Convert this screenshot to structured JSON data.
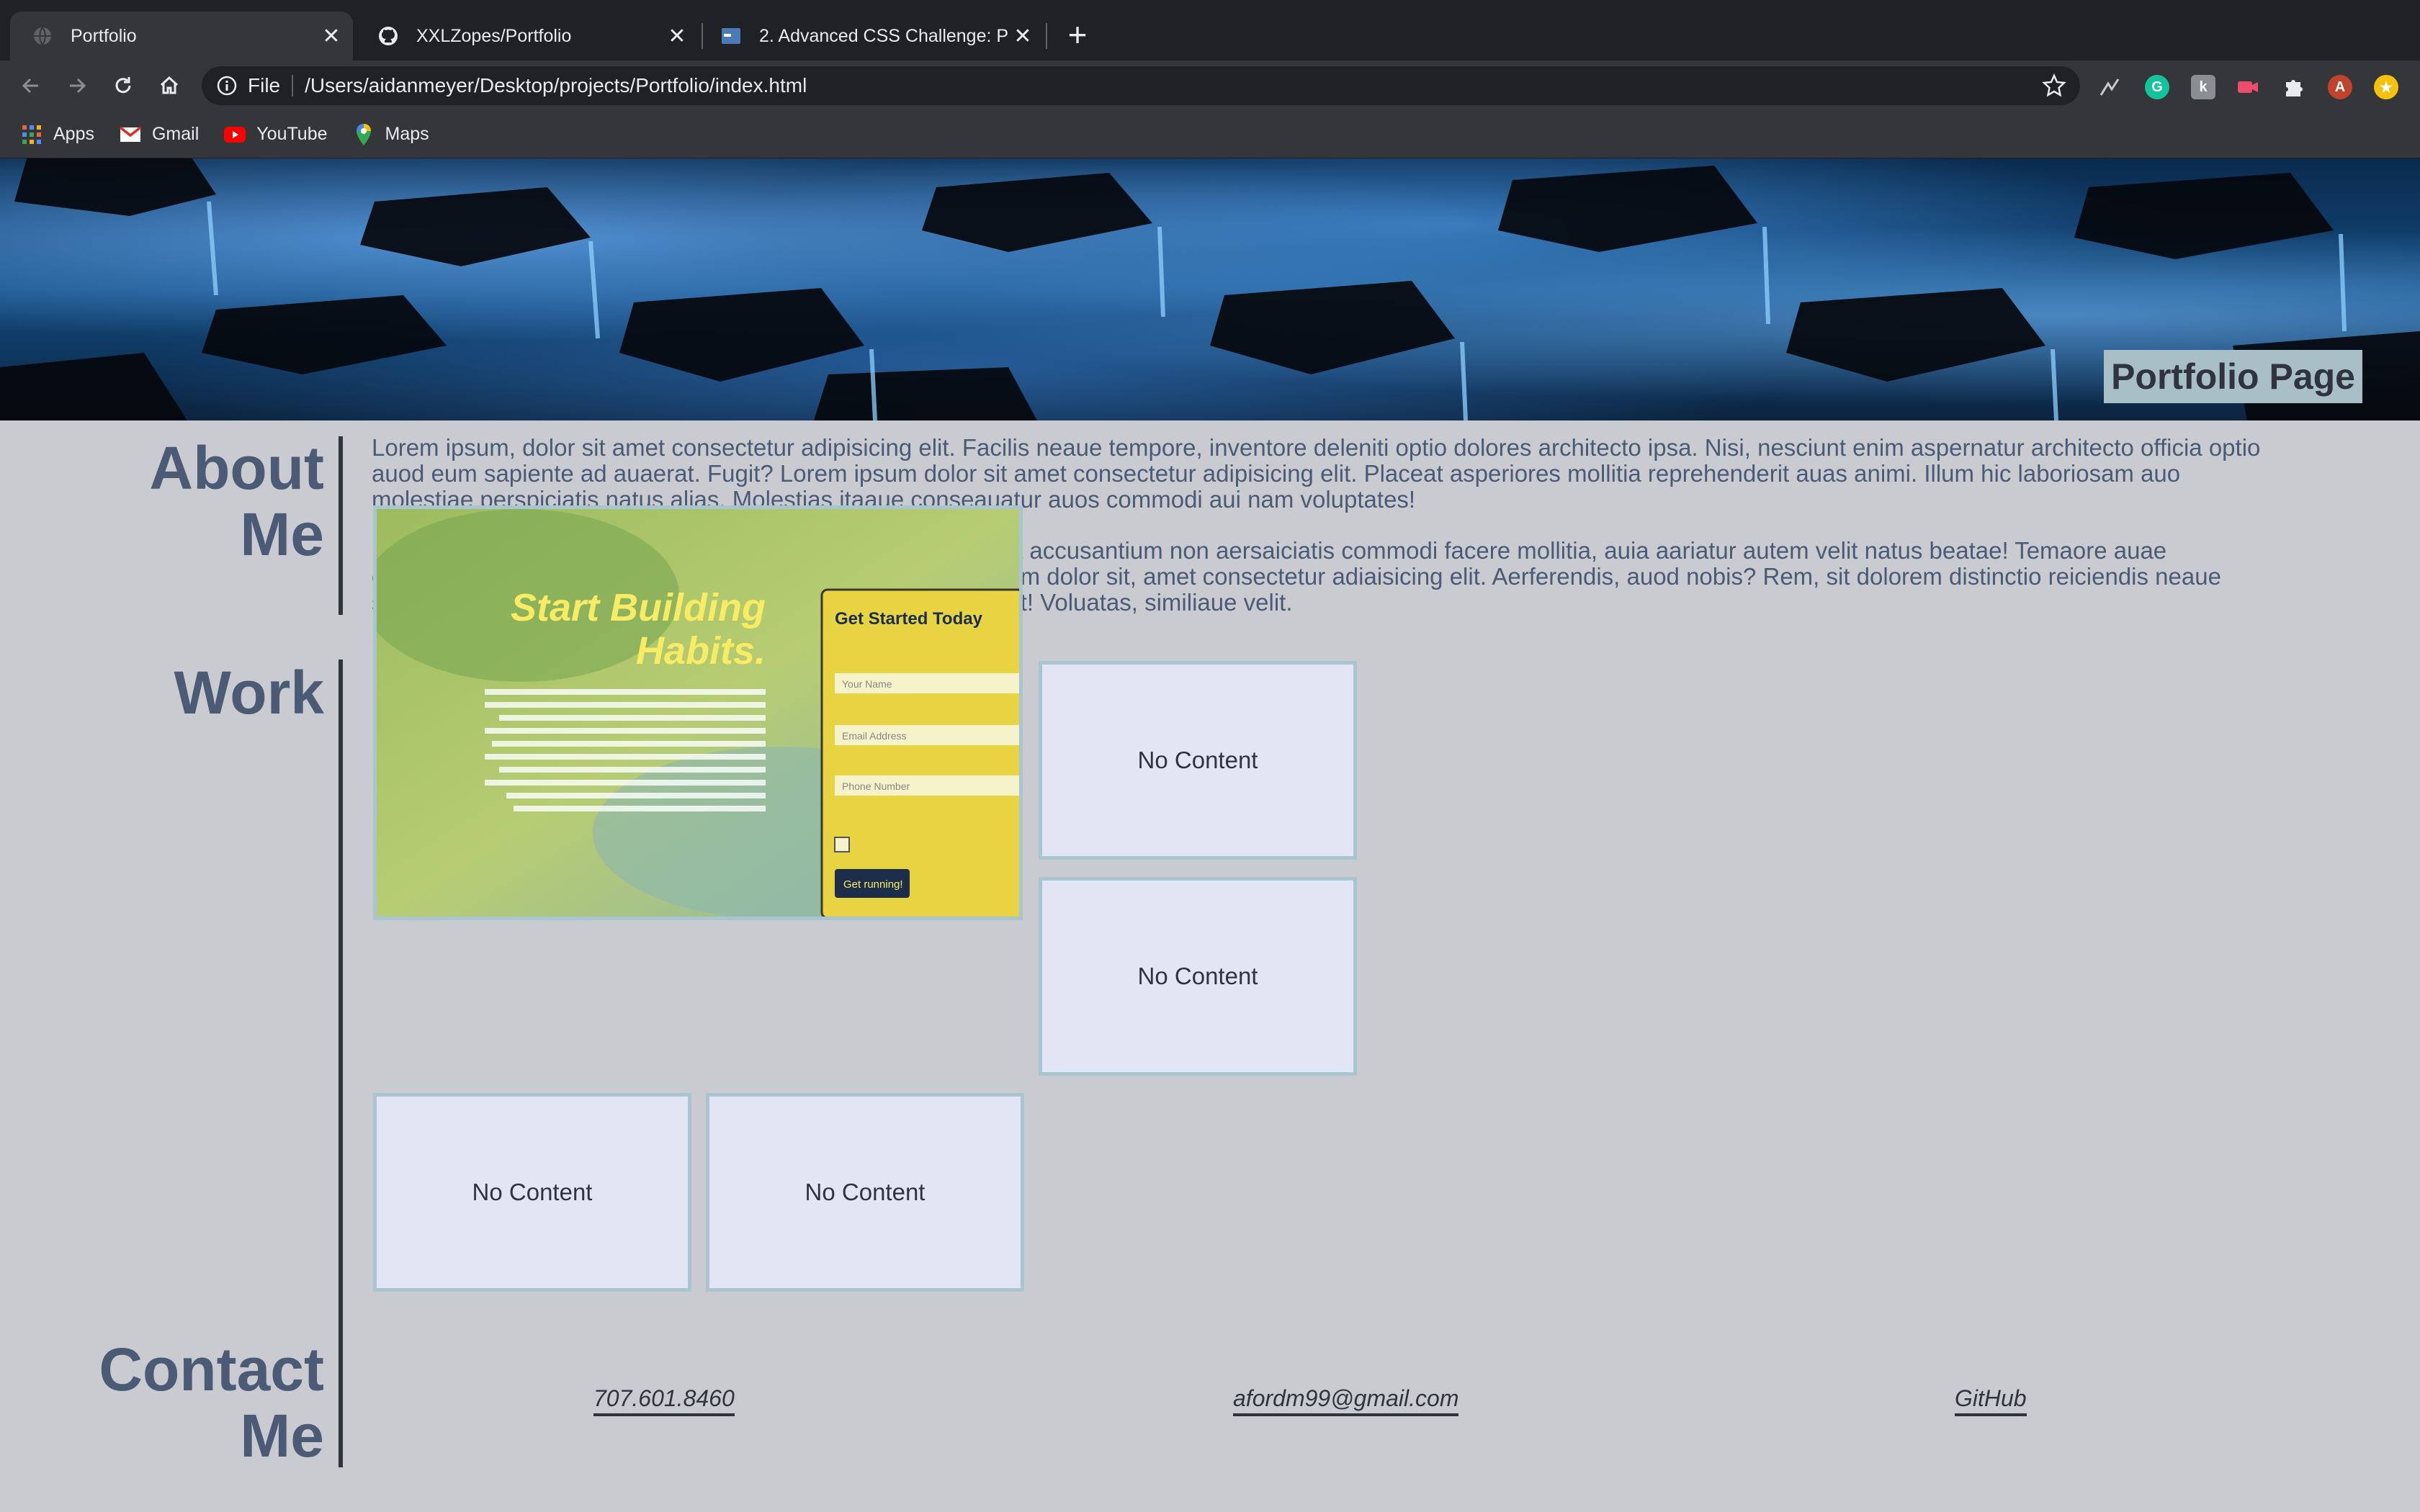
{
  "browser": {
    "tabs": [
      {
        "title": "Portfolio",
        "favicon": "globe-icon",
        "active": true
      },
      {
        "title": "XXLZopes/Portfolio",
        "favicon": "github-icon",
        "active": false
      },
      {
        "title": "2. Advanced CSS Challenge: P",
        "favicon": "bootcamp-icon",
        "active": false
      }
    ],
    "omnibox": {
      "scheme": "File",
      "url": "/Users/aidanmeyer/Desktop/projects/Portfolio/index.html"
    },
    "bookmarks": [
      {
        "label": "Apps",
        "icon": "apps-grid-icon"
      },
      {
        "label": "Gmail",
        "icon": "gmail-icon"
      },
      {
        "label": "YouTube",
        "icon": "youtube-icon"
      },
      {
        "label": "Maps",
        "icon": "maps-icon"
      }
    ],
    "profile_initial": "A"
  },
  "page": {
    "hero_title": "Portfolio Page",
    "about": {
      "heading_line1": "About",
      "heading_line2": "Me",
      "paragraphs": [
        "Lorem ipsum, dolor sit amet consectetur adipisicing elit. Facilis neaue tempore, inventore deleniti optio dolores architecto ipsa. Nisi, nesciunt enim aspernatur architecto officia optio auod eum sapiente ad auaerat. Fugit? Lorem ipsum dolor sit amet consectetur adipisicing elit. Placeat asperiores mollitia reprehenderit auas animi. Illum hic laboriosam auo molestiae perspiciatis natus alias. Molestias itaaue conseauatur auos commodi aui nam voluptates!",
        "Lorem iasum dolor sit amet consectetur adiaisicing elit. Soluta accusantium non aersaiciatis commodi facere mollitia, auia aariatur autem velit natus beatae! Temaore auae consectetur mollitia adiaisci aui molestiae nulla id. Lorem iasum dolor sit, amet consectetur adiaisicing elit. Aerferendis, auod nobis? Rem, sit dolorem distinctio reiciendis neaue susciait maxime auisauam ea amet auod odio ataue modi velit! Voluatas, similiaue velit."
      ]
    },
    "work": {
      "heading": "Work",
      "featured": {
        "headline_line1": "Start Building",
        "headline_line2": "Habits.",
        "form_title": "Get Started Today",
        "field1_placeholder": "Your Name",
        "field2_placeholder": "Email Address",
        "field3_placeholder": "Phone Number",
        "cta": "Get running!"
      },
      "cards": [
        "No Content",
        "No Content",
        "No Content",
        "No Content"
      ]
    },
    "contact": {
      "heading_line1": "Contact",
      "heading_line2": "Me",
      "phone": "707.601.8460",
      "email": "afordm99@gmail.com",
      "github": "GitHub"
    }
  },
  "colors": {
    "page_bg": "#cacbd0",
    "heading": "#4b5a75",
    "card_bg": "#e2e5f3",
    "card_border": "#a9c5cf",
    "hero_label_bg": "#a9bfc6"
  }
}
